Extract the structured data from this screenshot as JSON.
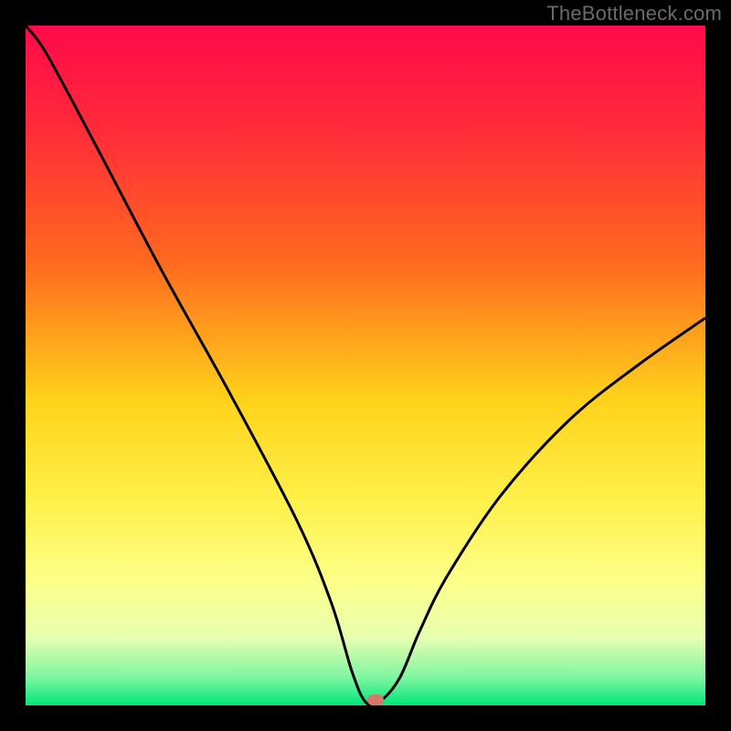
{
  "watermark": "TheBottleneck.com",
  "chart_data": {
    "type": "line",
    "title": "",
    "xlabel": "",
    "ylabel": "",
    "xlim": [
      0,
      100
    ],
    "ylim": [
      0,
      100
    ],
    "x": [
      0,
      3,
      10,
      20,
      30,
      40,
      45,
      48,
      50,
      52,
      55,
      58,
      62,
      70,
      80,
      90,
      100
    ],
    "y": [
      100,
      96,
      83,
      64,
      46,
      27,
      15,
      5,
      0.5,
      0.5,
      4,
      11,
      19,
      31,
      42,
      50,
      57
    ],
    "gradient_stops": [
      {
        "offset": 0.0,
        "color": "#ff0a4a"
      },
      {
        "offset": 0.15,
        "color": "#ff2a3a"
      },
      {
        "offset": 0.35,
        "color": "#ff6a1f"
      },
      {
        "offset": 0.55,
        "color": "#ffd21a"
      },
      {
        "offset": 0.7,
        "color": "#fff14a"
      },
      {
        "offset": 0.82,
        "color": "#fcff8a"
      },
      {
        "offset": 0.9,
        "color": "#e7ffb0"
      },
      {
        "offset": 0.96,
        "color": "#7cf5a0"
      },
      {
        "offset": 1.0,
        "color": "#00e67a"
      }
    ],
    "marker": {
      "x": 51.5,
      "y": 0.8,
      "color": "#d47a6a"
    },
    "curve_color": "#000000",
    "curve_width": 3
  }
}
